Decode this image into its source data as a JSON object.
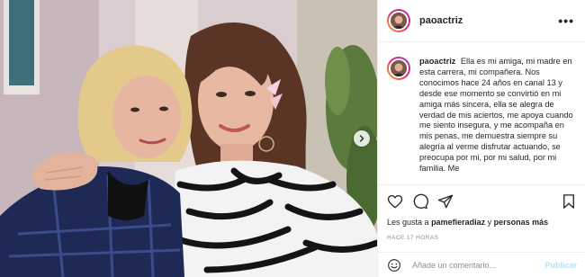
{
  "post": {
    "username": "paoactriz",
    "caption_username": "paoactriz",
    "caption": "Ella es mi amiga, mi madre en esta carrera, mi compañera. Nos conocimos hace 24 años en canal 13 y desde ese momento se convirtió en mi amiga más sincera, ella se alegra de verdad de mis aciertos, me apoya cuando me siento insegura, y me acompaña en mis penas, me demuestra siempre su alegría al verme disfrutar actuando, se preocupa por mi, por mi salud, por mi familia. Me",
    "likes_prefix": "Les gusta a",
    "likes_user": "pamefieradiaz",
    "likes_joiner": "y",
    "likes_suffix": "personas más",
    "timestamp": "HACE 17 HORAS"
  },
  "comment_box": {
    "placeholder": "Añade un comentario...",
    "publish_label": "Publicar"
  },
  "icons": {
    "more": "more-options-icon",
    "next": "chevron-right-icon",
    "like": "heart-icon",
    "comment": "comment-bubble-icon",
    "share": "paper-plane-icon",
    "save": "bookmark-icon",
    "emoji": "emoji-smile-icon"
  },
  "colors": {
    "story_ring_start": "#f9a93a",
    "story_ring_end": "#a331c4",
    "publish_disabled": "#b2dffc",
    "muted_text": "#8e8e8e"
  }
}
